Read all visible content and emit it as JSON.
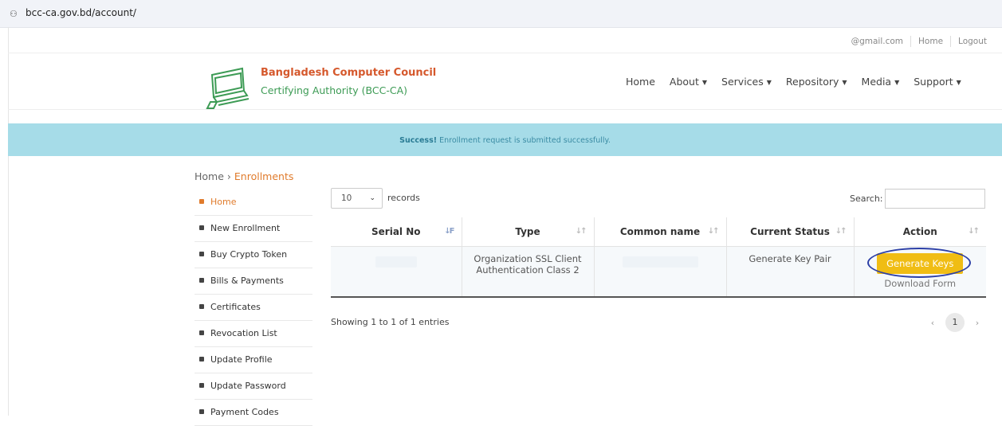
{
  "browser": {
    "url": "bcc-ca.gov.bd/account/",
    "site_icon": "tune-icon"
  },
  "toplinks": {
    "email": "@gmail.com",
    "home": "Home",
    "logout": "Logout"
  },
  "brand": {
    "title": "Bangladesh Computer Council",
    "subtitle": "Certifying Authority (BCC-CA)"
  },
  "nav": [
    {
      "label": "Home",
      "caret": false
    },
    {
      "label": "About",
      "caret": true
    },
    {
      "label": "Services",
      "caret": true
    },
    {
      "label": "Repository",
      "caret": true
    },
    {
      "label": "Media",
      "caret": true
    },
    {
      "label": "Support",
      "caret": true
    }
  ],
  "alert": {
    "strong": "Success!",
    "message": " Enrollment request is submitted successfully."
  },
  "breadcrumb": {
    "home": "Home",
    "sep": "›",
    "current": "Enrollments"
  },
  "sidebar": {
    "items": [
      {
        "label": "Home",
        "active": true
      },
      {
        "label": "New Enrollment"
      },
      {
        "label": "Buy Crypto Token"
      },
      {
        "label": "Bills & Payments"
      },
      {
        "label": "Certificates"
      },
      {
        "label": "Revocation List"
      },
      {
        "label": "Update Profile"
      },
      {
        "label": "Update Password"
      },
      {
        "label": "Payment Codes"
      }
    ]
  },
  "table_controls": {
    "page_length": "10",
    "records_label": "records",
    "search_label": "Search:",
    "search_value": ""
  },
  "table": {
    "columns": [
      "Serial No",
      "Type",
      "Common name",
      "Current Status",
      "Action"
    ],
    "rows": [
      {
        "serial": "",
        "type": "Organization SSL Client Authentication Class 2",
        "common_name": "",
        "status": "Generate Key Pair",
        "action_button": "Generate Keys",
        "action_link": "Download Form"
      }
    ]
  },
  "footer": {
    "showing": "Showing 1 to 1 of 1 entries",
    "prev": "‹",
    "page": "1",
    "next": "›"
  },
  "colors": {
    "accent_orange": "#e07b2c",
    "brand_green": "#3d9b55",
    "alert_bg": "#a6dce8",
    "button_yellow": "#f0bd14",
    "annotation_circle": "#2c3fa6"
  }
}
